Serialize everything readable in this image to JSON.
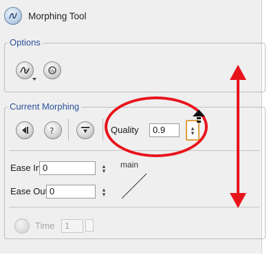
{
  "title": {
    "text": "Morphing Tool",
    "icon": "morph-tool-icon"
  },
  "options": {
    "label": "Options",
    "buttons": [
      {
        "name": "options-morph-menu-button",
        "icon": "morph-mode-icon"
      },
      {
        "name": "options-morph-button-2",
        "icon": "morph-half-icon"
      }
    ]
  },
  "current": {
    "label": "Current Morphing",
    "toolbar": [
      {
        "name": "go-to-previous-button",
        "icon": "step-back-icon"
      },
      {
        "name": "morph-help-button",
        "icon": "morph-help-icon"
      },
      {
        "name": "insert-key-button",
        "icon": "insert-down-icon"
      }
    ],
    "quality": {
      "label": "Quality",
      "value": "0.9"
    },
    "ease_in": {
      "label": "Ease In",
      "value": "0"
    },
    "ease_out": {
      "label": "Ease Out",
      "value": "0"
    },
    "curve_label": "main",
    "time": {
      "label": "Time",
      "value": "1"
    }
  },
  "colors": {
    "annotation": "#e8141c",
    "group_label": "#2b4f9a",
    "spinner_focus": "#e0a040"
  }
}
